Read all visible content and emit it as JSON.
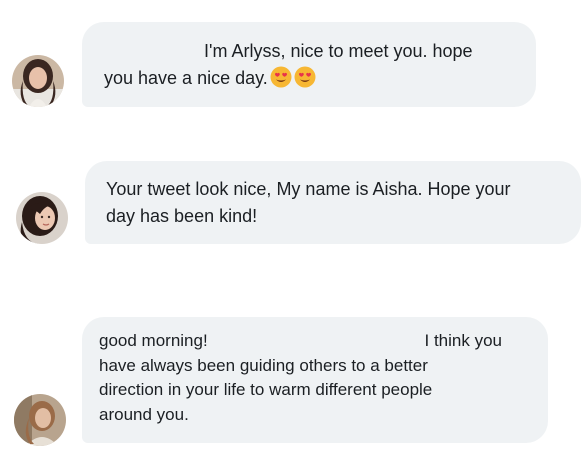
{
  "conversation": {
    "messages": [
      {
        "lines": [
          "I'm Arlyss, nice to meet you. hope",
          "you have a nice day."
        ],
        "trailing_icons": [
          "smiling-face-with-heart-eyes-icon",
          "smiling-face-with-heart-eyes-icon"
        ]
      },
      {
        "lines": [
          "Your tweet look nice, My name is Aisha. Hope your",
          "day has been kind!"
        ]
      },
      {
        "first_line_left": "good morning!",
        "first_line_right": "I think you",
        "lines": [
          "have always been guiding others to a better",
          "direction in your life to warm different people",
          "around you."
        ]
      }
    ]
  },
  "colors": {
    "bubble_background": "#eff2f4",
    "text": "#1b1f23",
    "emoji_face": "#f7b733",
    "emoji_heart": "#e8334a"
  }
}
